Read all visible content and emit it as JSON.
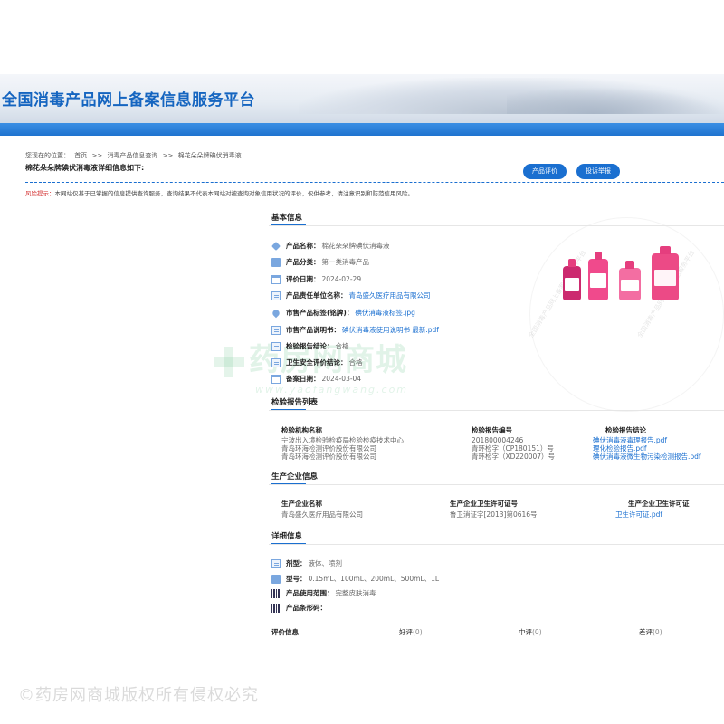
{
  "site": {
    "title": "全国消毒产品网上备案信息服务平台"
  },
  "breadcrumb": {
    "prefix": "您现在的位置：",
    "items": [
      "首页",
      ">>",
      "消毒产品信息查询",
      ">>",
      "棉花朵朵牌碘伏消毒液"
    ]
  },
  "page_heading": "棉花朵朵牌碘伏消毒液详细信息如下:",
  "actions": {
    "evaluate": "产品评价",
    "complain": "投诉举报"
  },
  "risk": {
    "label": "风险提示：",
    "text": "本网站仅基于已掌握的信息提供查询服务，查询结果不代表本网站对被查询对象信用状况的评价，仅供参考，请注意识别和防范信用风险。"
  },
  "basic": {
    "title": "基本信息",
    "rows": [
      {
        "label": "产品名称：",
        "value": "棉花朵朵牌碘伏消毒液",
        "icon": "tag-icon"
      },
      {
        "label": "产品分类：",
        "value": "第一类消毒产品",
        "icon": "category-icon"
      },
      {
        "label": "评价日期：",
        "value": "2024-02-29",
        "icon": "calendar-icon"
      },
      {
        "label": "产品责任单位名称：",
        "value": "青岛盛久医疗用品有限公司",
        "icon": "company-icon",
        "link": true
      },
      {
        "label": "市售产品标签(铭牌)：",
        "value": "碘伏消毒液标签.jpg",
        "icon": "label-icon",
        "link": true
      },
      {
        "label": "市售产品说明书：",
        "value": "碘伏消毒液使用说明书 最新.pdf",
        "icon": "manual-icon",
        "link": true
      },
      {
        "label": "检验报告结论：",
        "value": "合格",
        "icon": "report-icon"
      },
      {
        "label": "卫生安全评价结论：",
        "value": "合格",
        "icon": "safety-icon"
      },
      {
        "label": "备案日期：",
        "value": "2024-03-04",
        "icon": "calendar-icon"
      }
    ]
  },
  "reports": {
    "title": "检验报告列表",
    "headers": [
      "检验机构名称",
      "检验报告编号",
      "检验报告结论"
    ],
    "orgs": [
      "宁波出入境检验检疫局检验检疫技术中心",
      "青岛环海检测评价股份有限公司",
      "青岛环海检测评价股份有限公司"
    ],
    "numbers": [
      "201800004246",
      "青环检字（CP180151）号",
      "青环检字（XD220007）号"
    ],
    "conclusions": [
      "碘伏消毒液毒理报告.pdf",
      "理化检验报告.pdf",
      "碘伏消毒液微生物污染检测报告.pdf"
    ]
  },
  "producer": {
    "title": "生产企业信息",
    "headers": [
      "生产企业名称",
      "生产企业卫生许可证号",
      "生产企业卫生许可证"
    ],
    "name": "青岛盛久医疗用品有限公司",
    "license_no": "鲁卫消证字[2013]第0616号",
    "license_file": "卫生许可证.pdf"
  },
  "detail": {
    "title": "详细信息",
    "rows": [
      {
        "label": "剂型：",
        "value": "液体、喷剂",
        "icon": "dosage-icon"
      },
      {
        "label": "型号：",
        "value": "0.15mL、100mL、200mL、500mL、1L",
        "icon": "model-icon"
      },
      {
        "label": "产品使用范围：",
        "value": "完整皮肤消毒",
        "icon": "barcode-icon"
      },
      {
        "label": "产品条形码：",
        "value": "",
        "icon": "barcode-icon"
      }
    ]
  },
  "evaluation": {
    "title": "评价信息",
    "good_label": "好评",
    "good_count": "(0)",
    "mid_label": "中评",
    "mid_count": "(0)",
    "bad_label": "差评",
    "bad_count": "(0)"
  },
  "watermark": {
    "logo": "药房网商城",
    "logo_sub": "www.yaofangwang.com",
    "ring": "全国消毒产品网上备案信息服务平台",
    "bottom": "©药房网商城版权所有侵权必究"
  },
  "colors": {
    "accent": "#1a6fd0",
    "risk": "#d32f2f",
    "title": "#1565c0"
  }
}
